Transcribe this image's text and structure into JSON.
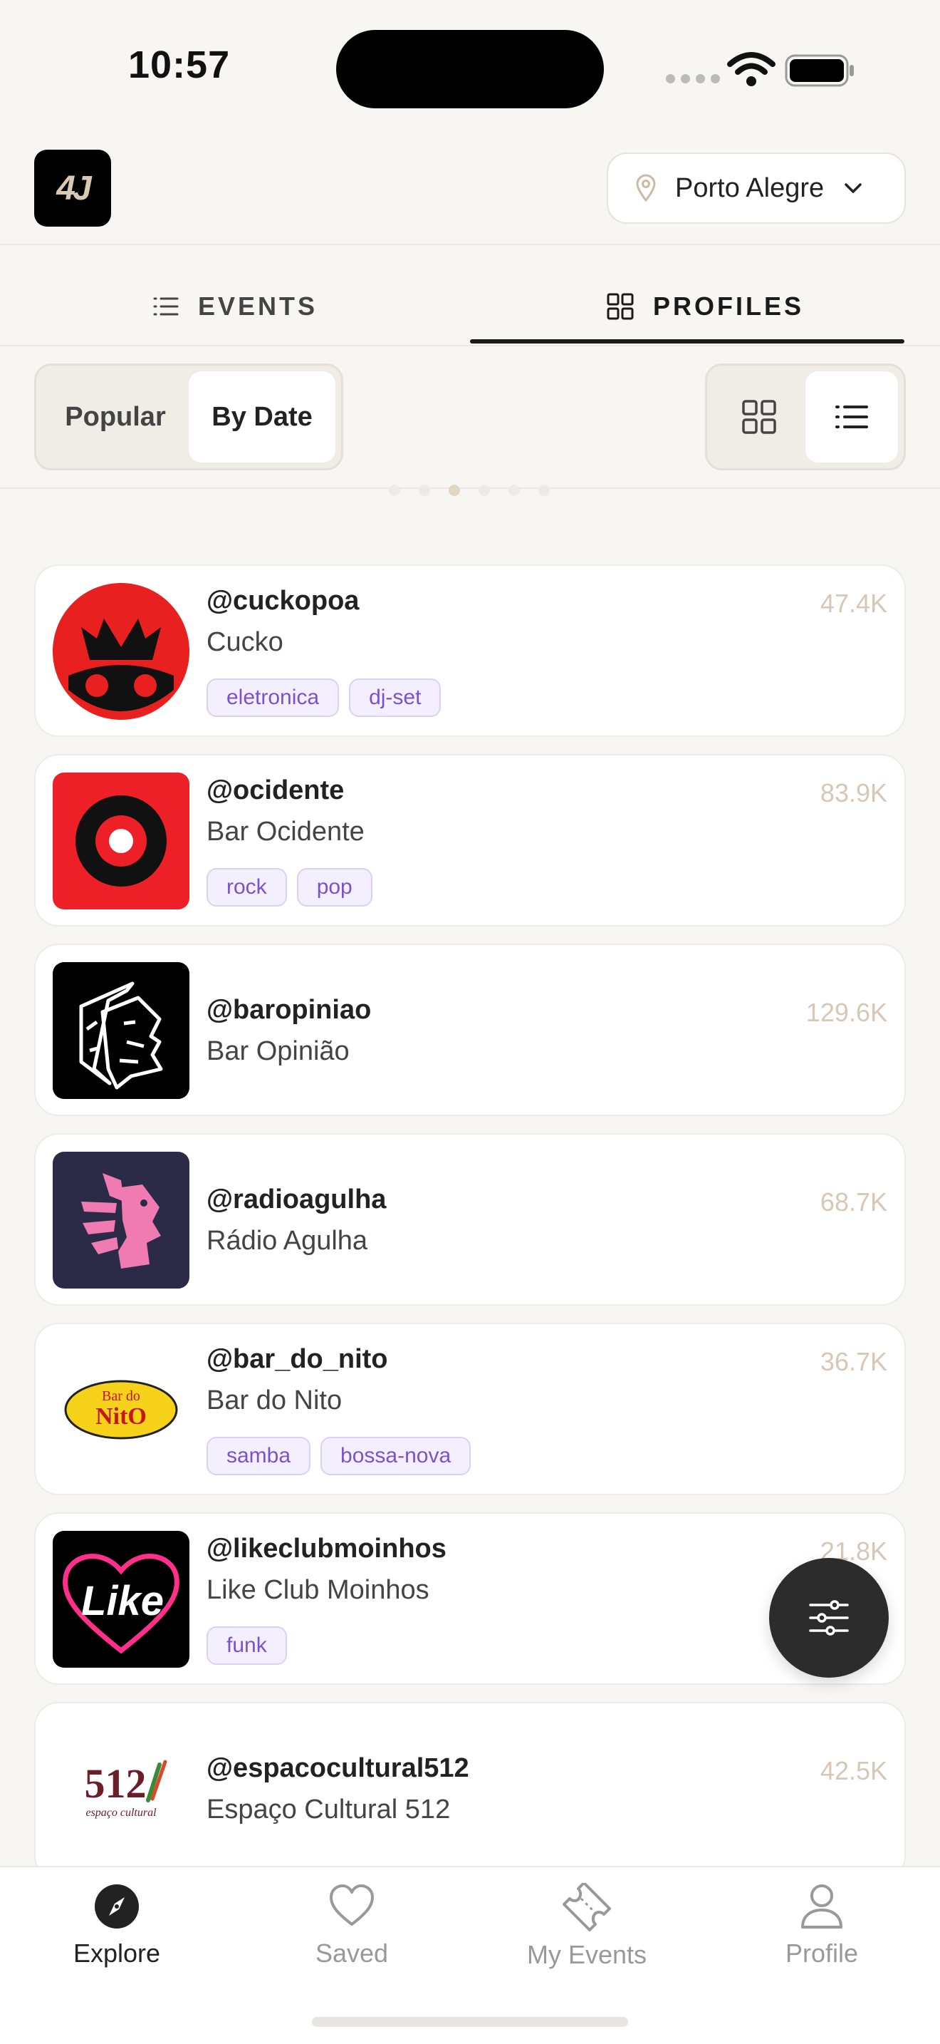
{
  "status": {
    "time": "10:57"
  },
  "header": {
    "logo_text": "4J",
    "city": "Porto Alegre"
  },
  "tabs": [
    {
      "label": "EVENTS",
      "icon": "list-icon",
      "active": false
    },
    {
      "label": "PROFILES",
      "icon": "grid-icon",
      "active": true
    }
  ],
  "sort": {
    "popular": "Popular",
    "by_date": "By Date",
    "selected": "By Date"
  },
  "view": {
    "options": [
      "grid-icon",
      "list-icon"
    ],
    "selected": "list"
  },
  "pager": {
    "count": 6,
    "active": 3
  },
  "profiles": [
    {
      "handle": "@cuckopoa",
      "name": "Cucko",
      "followers": "47.4K",
      "tags": [
        "eletronica",
        "dj-set"
      ]
    },
    {
      "handle": "@ocidente",
      "name": "Bar Ocidente",
      "followers": "83.9K",
      "tags": [
        "rock",
        "pop"
      ]
    },
    {
      "handle": "@baropiniao",
      "name": "Bar Opinião",
      "followers": "129.6K",
      "tags": []
    },
    {
      "handle": "@radioagulha",
      "name": "Rádio Agulha",
      "followers": "68.7K",
      "tags": []
    },
    {
      "handle": "@bar_do_nito",
      "name": "Bar do Nito",
      "followers": "36.7K",
      "tags": [
        "samba",
        "bossa-nova"
      ]
    },
    {
      "handle": "@likeclubmoinhos",
      "name": "Like Club Moinhos",
      "followers": "21.8K",
      "tags": [
        "funk"
      ]
    },
    {
      "handle": "@espacocultural512",
      "name": "Espaço Cultural 512",
      "followers": "42.5K",
      "tags": []
    }
  ],
  "avatar_text": {
    "bar_do_nito": "Bar do NitO",
    "like": "Like",
    "espaco": "512",
    "espaco_sub": "espaço cultural"
  },
  "nav": [
    {
      "label": "Explore",
      "icon": "compass-icon",
      "active": true
    },
    {
      "label": "Saved",
      "icon": "heart-icon",
      "active": false
    },
    {
      "label": "My Events",
      "icon": "ticket-icon",
      "active": false
    },
    {
      "label": "Profile",
      "icon": "user-icon",
      "active": false
    }
  ],
  "colors": {
    "accent": "#1a1a1a",
    "tag_bg": "#f4effe",
    "tag_text": "#7b52c9",
    "count": "#d7c7b6"
  }
}
